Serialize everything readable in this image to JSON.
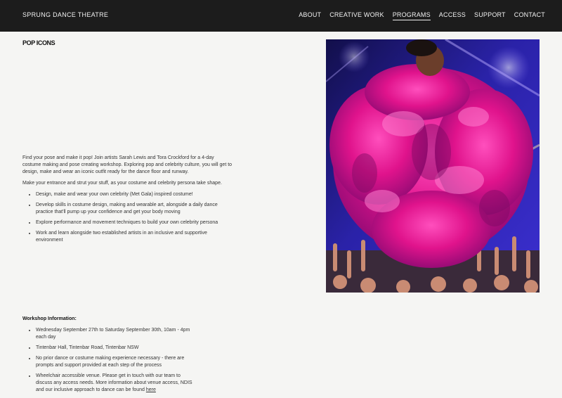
{
  "header": {
    "brand": "SPRUNG DANCE THEATRE",
    "nav": [
      {
        "label": "ABOUT",
        "active": false
      },
      {
        "label": "CREATIVE WORK",
        "active": false
      },
      {
        "label": "PROGRAMS",
        "active": true
      },
      {
        "label": "ACCESS",
        "active": false
      },
      {
        "label": "SUPPORT",
        "active": false
      },
      {
        "label": "CONTACT",
        "active": false
      }
    ]
  },
  "page": {
    "title": "POP ICONS"
  },
  "intro": {
    "paragraph_1": "Find your pose and make it pop! Join artists Sarah Lewis and Tora Crockford for a 4-day costume making and pose creating workshop. Exploring pop and celebrity culture, you will get to design, make and wear an iconic outfit ready for the dance floor and runway.",
    "paragraph_2": "Make your entrance and strut your stuff, as your costume and celebrity persona take shape.",
    "bullets": [
      "Design, make and wear your own celebrity (Met Gala) inspired costume!",
      "Develop skills in costume design, making and wearable art, alongside a daily dance practice that'll pump up your confidence and get your body moving",
      "Explore performance and movement techniques to build your own celebrity persona",
      "Work and learn alongside two established artists in an inclusive and supportive environment"
    ]
  },
  "workshop": {
    "heading": "Workshop Information:",
    "dates": "Wednesday September 27th to Saturday September 30th, 10am - 4pm each day",
    "venue": "Tintenbar Hall, Tintenbar Road, Tintenbar NSW",
    "experience": "No prior dance or costume making experience necessary - there are prompts and support provided at each step of the process",
    "access_text": "Wheelchair accessible venue. Please get in touch with our team to discuss any access needs. More information about venue access, NDIS and our inclusive approach to dance can be found ",
    "access_link": "here"
  },
  "colors": {
    "header_bg": "#1c1c1c",
    "page_bg": "#f5f5f3",
    "feather_magenta": "#e0138c",
    "stage_blue": "#2a22a8"
  },
  "icons": []
}
